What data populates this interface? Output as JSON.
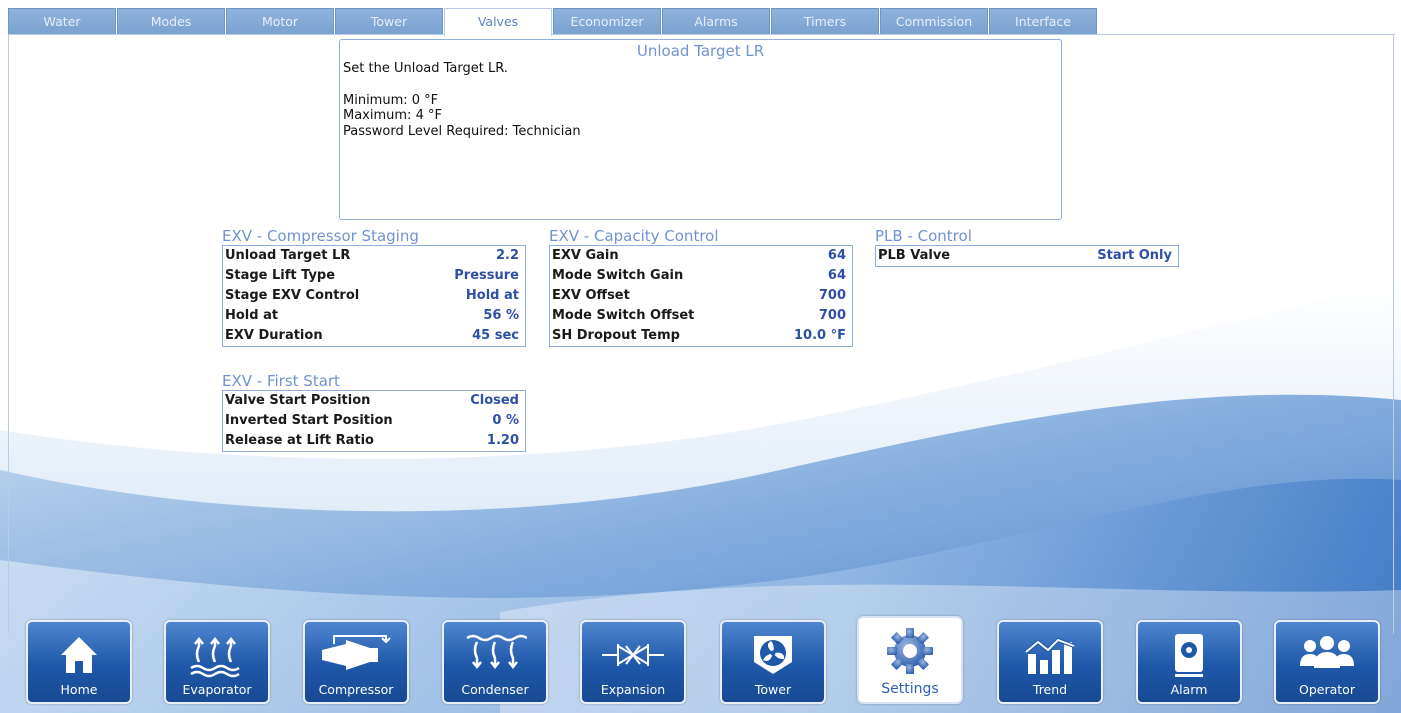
{
  "tabs": [
    {
      "label": "Water",
      "active": false
    },
    {
      "label": "Modes",
      "active": false
    },
    {
      "label": "Motor",
      "active": false
    },
    {
      "label": "Tower",
      "active": false
    },
    {
      "label": "Valves",
      "active": true
    },
    {
      "label": "Economizer",
      "active": false
    },
    {
      "label": "Alarms",
      "active": false
    },
    {
      "label": "Timers",
      "active": false
    },
    {
      "label": "Commission",
      "active": false
    },
    {
      "label": "Interface",
      "active": false
    }
  ],
  "info": {
    "title": "Unload Target LR",
    "description": "Set the Unload Target LR.",
    "minimum": "Minimum: 0 °F",
    "maximum": "Maximum: 4 °F",
    "password": "Password Level Required: Technician"
  },
  "staging": {
    "title": "EXV - Compressor Staging",
    "rows": [
      {
        "label": "Unload Target LR",
        "value": "2.2"
      },
      {
        "label": "Stage Lift Type",
        "value": "Pressure"
      },
      {
        "label": "Stage EXV Control",
        "value": "Hold at"
      },
      {
        "label": "Hold at",
        "value": "56 %"
      },
      {
        "label": "EXV Duration",
        "value": "45 sec"
      }
    ]
  },
  "capacity": {
    "title": "EXV - Capacity Control",
    "rows": [
      {
        "label": "EXV Gain",
        "value": "64"
      },
      {
        "label": "Mode Switch Gain",
        "value": "64"
      },
      {
        "label": "EXV Offset",
        "value": "700"
      },
      {
        "label": "Mode Switch Offset",
        "value": "700"
      },
      {
        "label": "SH Dropout Temp",
        "value": "10.0 °F"
      }
    ]
  },
  "plb": {
    "title": "PLB - Control",
    "rows": [
      {
        "label": "PLB Valve",
        "value": "Start Only"
      }
    ]
  },
  "first_start": {
    "title": "EXV - First Start",
    "rows": [
      {
        "label": "Valve Start Position",
        "value": "Closed"
      },
      {
        "label": "Inverted Start Position",
        "value": "0 %"
      },
      {
        "label": "Release at Lift Ratio",
        "value": "1.20"
      }
    ]
  },
  "nav": [
    {
      "label": "Home",
      "icon": "home-icon"
    },
    {
      "label": "Evaporator",
      "icon": "evaporator-icon"
    },
    {
      "label": "Compressor",
      "icon": "compressor-icon"
    },
    {
      "label": "Condenser",
      "icon": "condenser-icon"
    },
    {
      "label": "Expansion",
      "icon": "expansion-valve-icon"
    },
    {
      "label": "Tower",
      "icon": "fan-icon"
    },
    {
      "label": "Settings",
      "icon": "gear-icon",
      "active": true
    },
    {
      "label": "Trend",
      "icon": "trend-chart-icon"
    },
    {
      "label": "Alarm",
      "icon": "alarm-icon"
    },
    {
      "label": "Operator",
      "icon": "users-icon"
    }
  ],
  "colors": {
    "accent": "#6f93cf",
    "value_text": "#2e4fa6",
    "nav_button": "#1f57a9"
  }
}
